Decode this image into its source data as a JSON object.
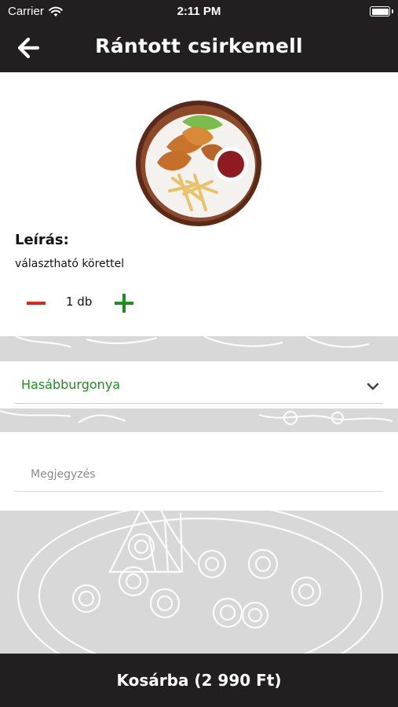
{
  "status_bar": {
    "carrier": "Carrier",
    "time": "2:11 PM"
  },
  "nav": {
    "title": "Rántott csirkemell",
    "back_icon": "arrow-left-icon"
  },
  "product": {
    "image_icon": "fried-chicken-plate-image",
    "description_heading": "Leírás:",
    "description": "választható körettel",
    "quantity_label": "1 db"
  },
  "side_dish": {
    "selected": "Hasábburgonya",
    "selected_color": "#1a8f1a",
    "chevron_icon": "chevron-down-icon"
  },
  "note": {
    "placeholder": "Megjegyzés",
    "value": ""
  },
  "cart": {
    "button_label": "Kosárba (2 990 Ft)"
  },
  "colors": {
    "bar_background": "#231f20",
    "minus": "#e1251b",
    "plus": "#1a8f1a"
  }
}
